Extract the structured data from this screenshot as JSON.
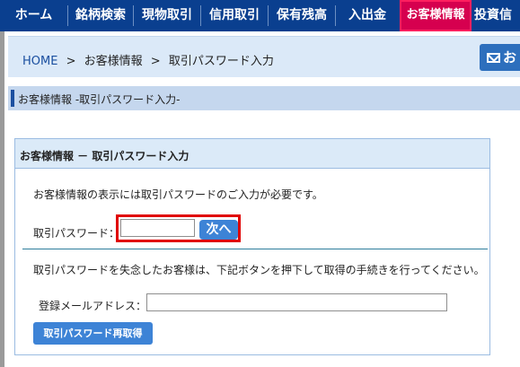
{
  "nav": {
    "items": [
      {
        "label": "ホーム"
      },
      {
        "label": "銘柄検索"
      },
      {
        "label": "現物取引"
      },
      {
        "label": "信用取引"
      },
      {
        "label": "保有残高"
      },
      {
        "label": "入出金"
      },
      {
        "label": "お客様情報",
        "active": true
      },
      {
        "label": "投資信"
      }
    ],
    "bg_color": "#0a3f8f",
    "active_color": "#d6004f"
  },
  "breadcrumb": {
    "home": "HOME",
    "separator": ">",
    "level1": "お客様情報",
    "level2": "取引パスワード入力"
  },
  "mail_button": {
    "icon": "envelope-icon",
    "label": "お"
  },
  "section_title": "お客様情報 -取引パスワード入力-",
  "panel": {
    "title": "お客様情報 － 取引パスワード入力",
    "notice": "お客様情報の表示には取引パスワードのご入力が必要です。",
    "password_label": "取引パスワード：",
    "password_value": "",
    "next_button": "次へ",
    "lost_note": "取引パスワードを失念したお客様は、下記ボタンを押下して取得の手続きを行ってください。",
    "email_label": "登録メールアドレス：",
    "email_value": "",
    "reissue_button": "取引パスワード再取得"
  }
}
